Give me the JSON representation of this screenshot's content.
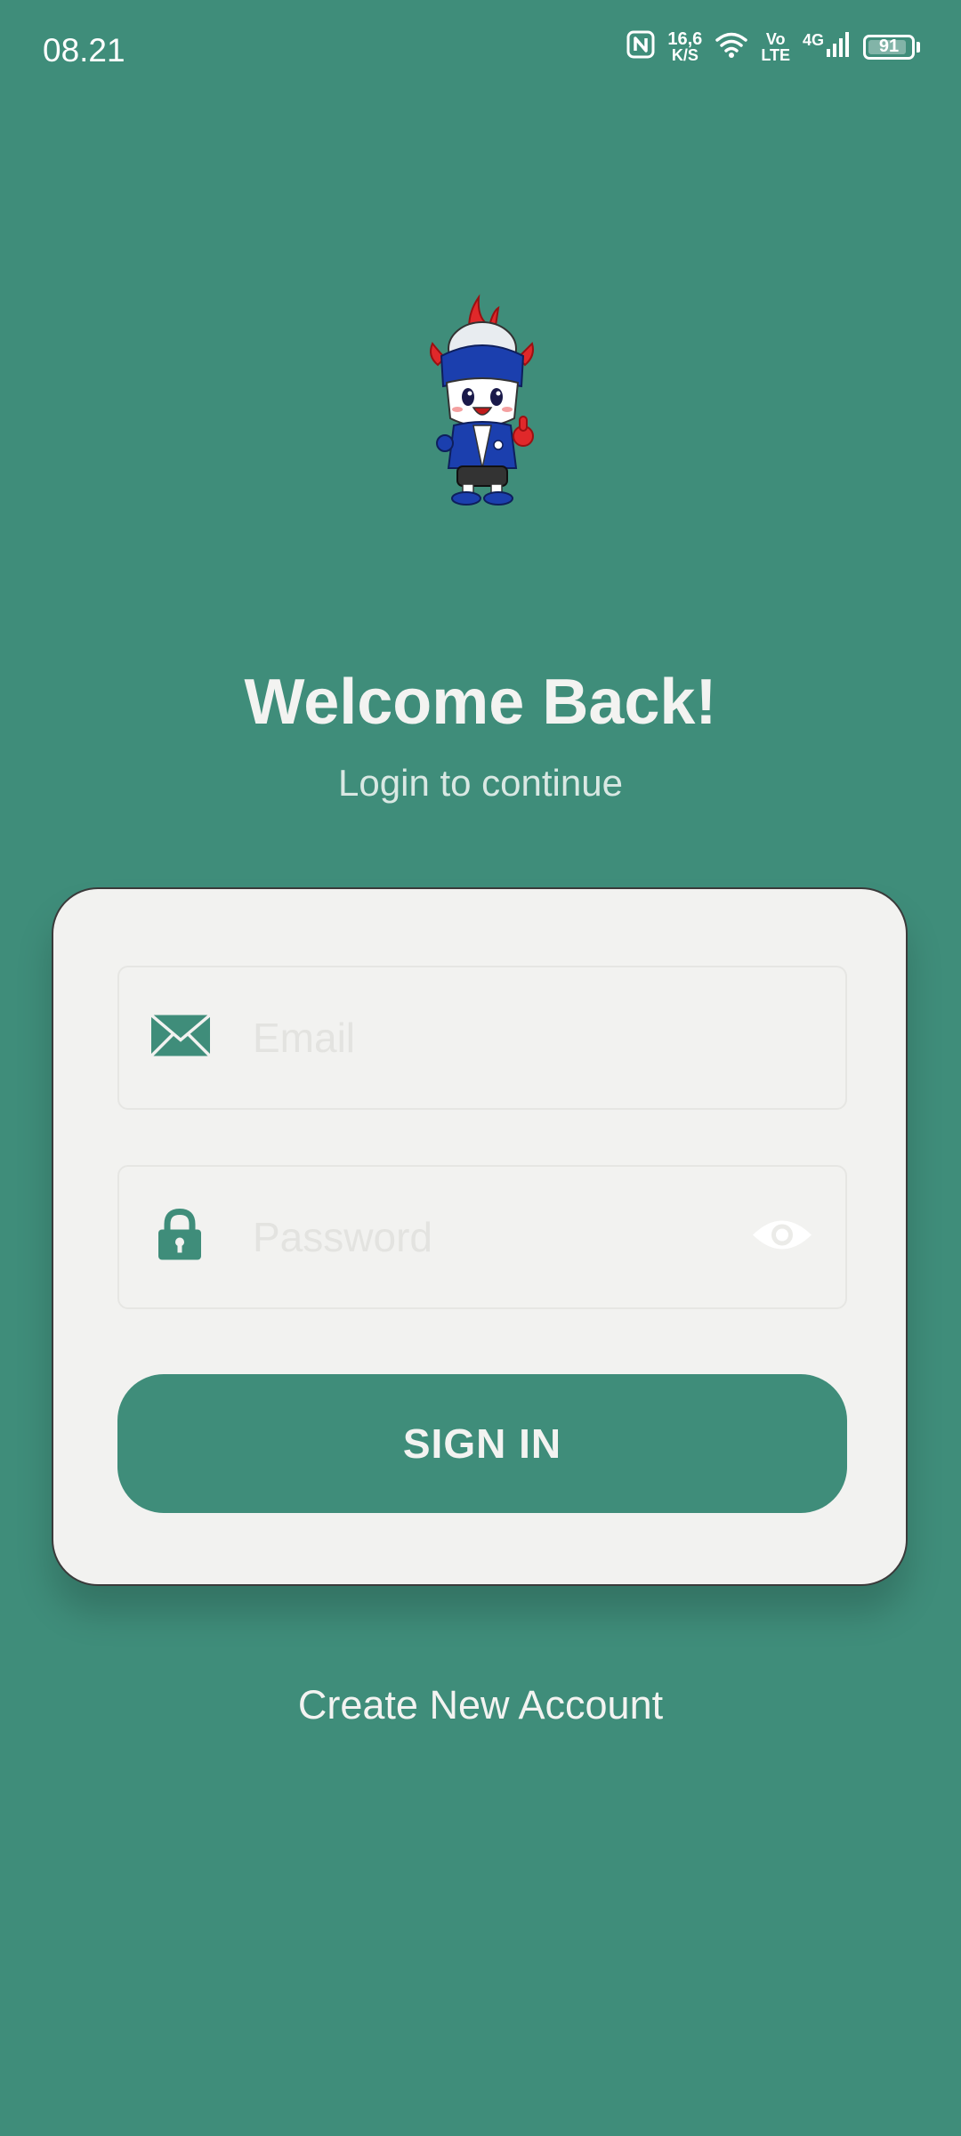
{
  "status_bar": {
    "time": "08.21",
    "net_speed_value": "16,6",
    "net_speed_unit": "K/S",
    "volte_top": "Vo",
    "volte_bottom": "LTE",
    "network_type": "4G",
    "battery_level": "91",
    "battery_fraction": 0.91
  },
  "header": {
    "title": "Welcome Back!",
    "subtitle": "Login to continue"
  },
  "form": {
    "email": {
      "value": "",
      "placeholder": "Email"
    },
    "password": {
      "value": "",
      "placeholder": "Password"
    },
    "sign_in_label": "SIGN IN"
  },
  "footer": {
    "create_account_label": "Create New Account"
  },
  "colors": {
    "background": "#3f8d7a",
    "card": "#f2f2f0",
    "accent": "#3f8d7a"
  },
  "icons": {
    "nfc": "nfc-icon",
    "wifi": "wifi-icon",
    "signal": "signal-icon",
    "battery": "battery-icon",
    "email": "envelope-icon",
    "password": "lock-icon",
    "toggle_visibility": "eye-icon",
    "mascot": "mascot-logo"
  }
}
